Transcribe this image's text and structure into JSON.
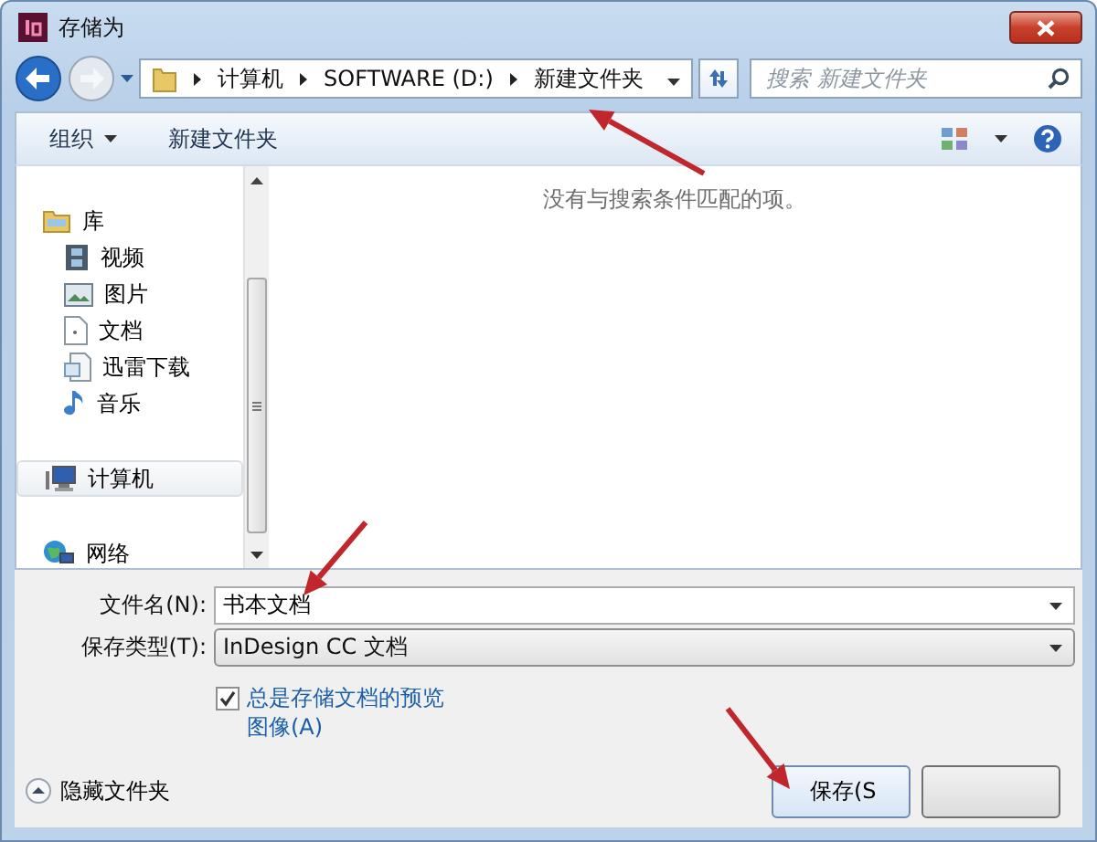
{
  "window": {
    "title": "存储为"
  },
  "address": {
    "crumbs": [
      "计算机",
      "SOFTWARE (D:)",
      "新建文件夹"
    ]
  },
  "search": {
    "placeholder": "搜索 新建文件夹"
  },
  "toolbar": {
    "organize": "组织",
    "new_folder": "新建文件夹"
  },
  "nav": {
    "items": [
      {
        "label": "库",
        "kind": "library",
        "selected": false,
        "children": [
          {
            "label": "视频",
            "kind": "video",
            "selected": false
          },
          {
            "label": "图片",
            "kind": "picture",
            "selected": false
          },
          {
            "label": "文档",
            "kind": "document",
            "selected": false
          },
          {
            "label": "迅雷下载",
            "kind": "download",
            "selected": false
          },
          {
            "label": "音乐",
            "kind": "music",
            "selected": false
          }
        ]
      },
      {
        "label": "计算机",
        "kind": "computer",
        "selected": true
      },
      {
        "label": "网络",
        "kind": "network",
        "selected": false
      }
    ]
  },
  "content": {
    "empty_message": "没有与搜索条件匹配的项。"
  },
  "form": {
    "filename_label": "文件名(N):",
    "filename": "书本文档",
    "type_label": "保存类型(T):",
    "type": "InDesign CC 文档",
    "preview": {
      "label": "总是存储文档的预览图像(A)",
      "checked": true
    }
  },
  "hide_folders": "隐藏文件夹",
  "save_button": "保存(S"
}
